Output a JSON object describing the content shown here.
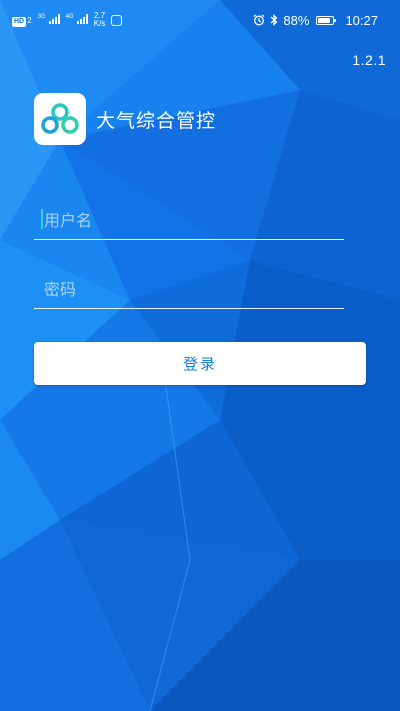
{
  "status_bar": {
    "hd_label": "HD",
    "hd_sub": "2",
    "net1": "3G",
    "net2": "4G",
    "speed_value": "2.7",
    "speed_unit": "K/s",
    "battery_percent": "88%",
    "battery_level": 0.88,
    "time": "10:27",
    "icons": [
      "alarm-icon",
      "bluetooth-icon",
      "battery-icon",
      "app-notification-icon"
    ]
  },
  "app": {
    "version": "1.2.1",
    "title": "大气综合管控",
    "logo_icon": "connected-rings-logo",
    "brand_colors": {
      "background": "#1273e6",
      "logo_teal": "#2fc5c2"
    }
  },
  "login": {
    "username_placeholder": "用户名",
    "username_value": "",
    "password_placeholder": "密码",
    "password_value": "",
    "submit_label": "登录",
    "submit_color": "#1b7fe0"
  }
}
